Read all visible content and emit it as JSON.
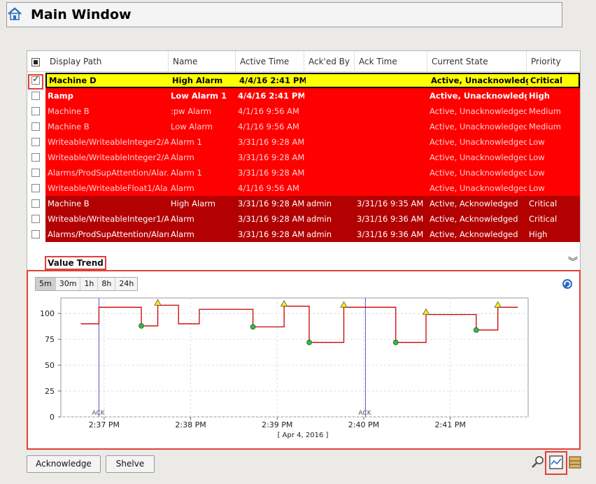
{
  "window": {
    "title": "Main Window"
  },
  "table": {
    "columns": [
      "Display Path",
      "Name",
      "Active Time",
      "Ack'ed By",
      "Ack Time",
      "Current State",
      "Priority"
    ],
    "rows": [
      {
        "style": "yellow",
        "checked": true,
        "cells": [
          "Machine D",
          "High Alarm",
          "4/4/16 2:41 PM",
          "",
          "",
          "Active, Unacknowledg...",
          "Critical"
        ]
      },
      {
        "style": "red-bold",
        "checked": false,
        "cells": [
          "Ramp",
          "Low Alarm 1",
          "4/4/16 2:41 PM",
          "",
          "",
          "Active, Unacknowledg...",
          "High"
        ]
      },
      {
        "style": "red",
        "checked": false,
        "cells": [
          "Machine B",
          ":pw Alarm",
          "4/1/16 9:56 AM",
          "",
          "",
          "Active, Unacknowledged",
          "Medium"
        ]
      },
      {
        "style": "red",
        "checked": false,
        "cells": [
          "Machine B",
          "Low Alarm",
          "4/1/16 9:56 AM",
          "",
          "",
          "Active, Unacknowledged",
          "Medium"
        ]
      },
      {
        "style": "red",
        "checked": false,
        "cells": [
          "Writeable/WriteableInteger2/A...",
          "Alarm 1",
          "3/31/16 9:28 AM",
          "",
          "",
          "Active, Unacknowledged",
          "Low"
        ]
      },
      {
        "style": "red",
        "checked": false,
        "cells": [
          "Writeable/WriteableInteger2/A...",
          "Alarm",
          "3/31/16 9:28 AM",
          "",
          "",
          "Active, Unacknowledged",
          "Low"
        ]
      },
      {
        "style": "red",
        "checked": false,
        "cells": [
          "Alarms/ProdSupAttention/Alar...",
          "Alarm 1",
          "3/31/16 9:28 AM",
          "",
          "",
          "Active, Unacknowledged",
          "Low"
        ]
      },
      {
        "style": "red",
        "checked": false,
        "cells": [
          "Writeable/WriteableFloat1/Ala...",
          "Alarm",
          "4/1/16 9:56 AM",
          "",
          "",
          "Active, Unacknowledged",
          "Low"
        ]
      },
      {
        "style": "dark",
        "checked": false,
        "cells": [
          "Machine B",
          "High Alarm",
          "3/31/16 9:28 AM",
          "admin",
          "3/31/16 9:35 AM",
          "Active, Acknowledged",
          "Critical"
        ]
      },
      {
        "style": "dark",
        "checked": false,
        "cells": [
          "Writeable/WriteableInteger1/A...",
          "Alarm",
          "3/31/16 9:28 AM",
          "admin",
          "3/31/16 9:36 AM",
          "Active, Acknowledged",
          "Critical"
        ]
      },
      {
        "style": "dark",
        "checked": false,
        "cells": [
          "Alarms/ProdSupAttention/Alarm",
          "Alarm",
          "3/31/16 9:28 AM",
          "admin",
          "3/31/16 9:36 AM",
          "Active, Acknowledged",
          "High"
        ]
      }
    ]
  },
  "trend": {
    "tab_label": "Value Trend",
    "ranges": [
      "5m",
      "30m",
      "1h",
      "8h",
      "24h"
    ],
    "active_range": "5m"
  },
  "chart_data": {
    "type": "line",
    "xlabel": "[ Apr 4, 2016 ]",
    "x_ticks": [
      "2:37 PM",
      "2:38 PM",
      "2:39 PM",
      "2:40 PM",
      "2:41 PM"
    ],
    "x_tick_minutes": [
      37,
      38,
      39,
      40,
      41
    ],
    "xlim_minutes": [
      36.5,
      41.9
    ],
    "ylim": [
      0,
      115
    ],
    "y_ticks": [
      0,
      25,
      50,
      75,
      100
    ],
    "grid": true,
    "series": [
      {
        "color": "#cc0000",
        "points": [
          [
            36.73,
            90
          ],
          [
            36.94,
            90
          ],
          [
            36.94,
            106
          ],
          [
            37.43,
            106
          ],
          [
            37.43,
            88
          ],
          [
            37.62,
            88
          ],
          [
            37.62,
            108
          ],
          [
            37.86,
            108
          ],
          [
            37.86,
            90
          ],
          [
            38.1,
            90
          ],
          [
            38.1,
            104
          ],
          [
            38.72,
            104
          ],
          [
            38.72,
            87
          ],
          [
            39.08,
            87
          ],
          [
            39.08,
            107
          ],
          [
            39.37,
            107
          ],
          [
            39.37,
            72
          ],
          [
            39.77,
            72
          ],
          [
            39.77,
            106
          ],
          [
            40.37,
            106
          ],
          [
            40.37,
            72
          ],
          [
            40.72,
            72
          ],
          [
            40.72,
            99
          ],
          [
            41.3,
            99
          ],
          [
            41.3,
            84
          ],
          [
            41.55,
            84
          ],
          [
            41.55,
            106
          ],
          [
            41.78,
            106
          ]
        ]
      }
    ],
    "ack_markers": [
      {
        "x": 36.94,
        "label": "ACK"
      },
      {
        "x": 40.02,
        "label": "ACK"
      }
    ],
    "triangle_markers": [
      [
        37.62,
        108
      ],
      [
        39.08,
        107
      ],
      [
        39.77,
        106
      ],
      [
        40.72,
        99
      ],
      [
        41.55,
        106
      ]
    ],
    "circle_markers": [
      [
        37.43,
        88
      ],
      [
        38.72,
        87
      ],
      [
        39.37,
        72
      ],
      [
        40.37,
        72
      ],
      [
        41.3,
        84
      ]
    ]
  },
  "buttons": {
    "acknowledge": "Acknowledge",
    "shelve": "Shelve"
  }
}
